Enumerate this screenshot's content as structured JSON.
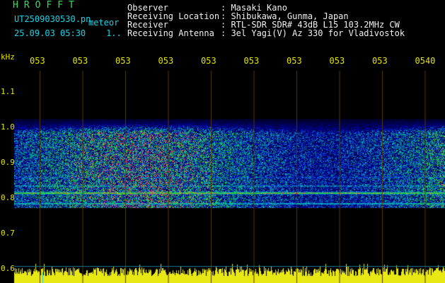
{
  "header": {
    "brand": "HROFFT",
    "filename": "UT2509030530.pn",
    "meteor_label": "meteor",
    "datetime": "25.09.03 05:30",
    "marker": "1.."
  },
  "meta": [
    {
      "label": "Observer",
      "value": ": Masaki Kano"
    },
    {
      "label": "Receiving Location",
      "value": ": Shibukawa, Gunma, Japan"
    },
    {
      "label": "Receiver",
      "value": ": RTL-SDR SDR# 43dB L15 103.2MHz CW"
    },
    {
      "label": "Receiving Antenna",
      "value": ": 3el Yagi(V) Az 330 for Vladivostok"
    }
  ],
  "colors": {
    "axis_text": "#e4e400",
    "grid": "#5a3b00",
    "meta_text": "#f0f0f0",
    "brand": "#33e05a"
  },
  "chart_data": {
    "type": "heatmap",
    "ylabel": "kHz",
    "y_ticks": [
      "1.1",
      "1.0",
      "0.9",
      "0.8",
      "0.7",
      "0.6"
    ],
    "ylim": [
      0.6,
      1.15
    ],
    "x_ticks": [
      "053",
      "053",
      "053",
      "053",
      "053",
      "053",
      "053",
      "053",
      "053",
      "0540"
    ],
    "signal_band_khz": [
      0.78,
      1.0
    ],
    "strong_line_khz": 0.815,
    "secondary_line_khz": 0.785
  }
}
